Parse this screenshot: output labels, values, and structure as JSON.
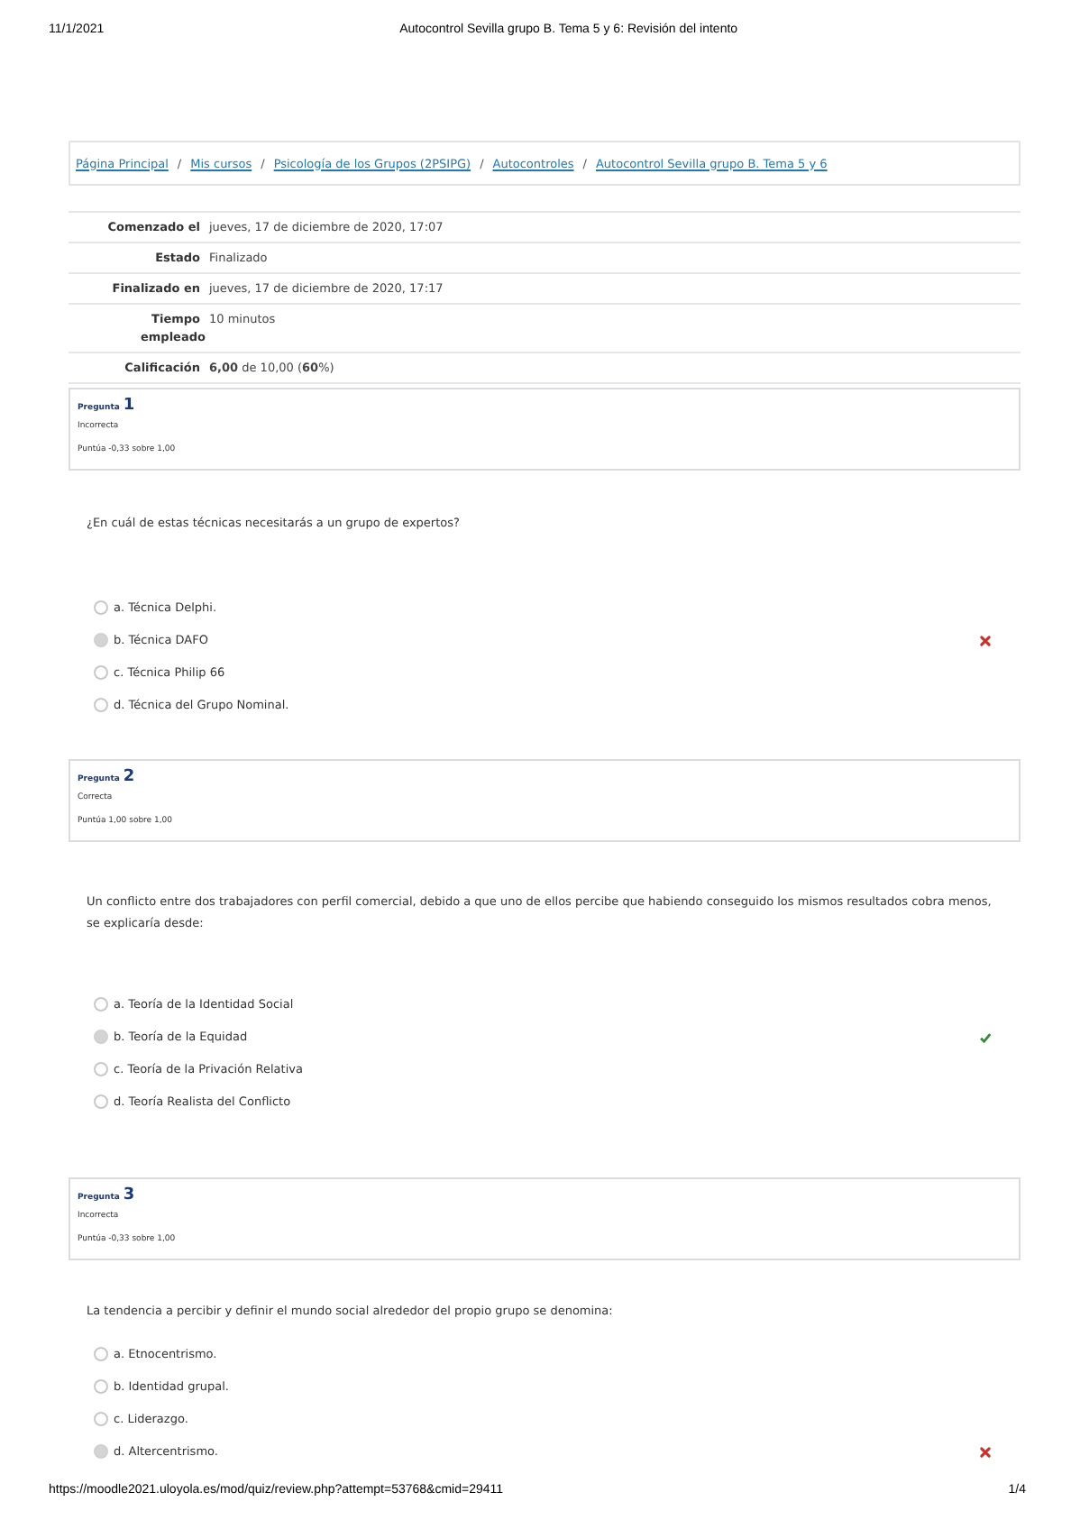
{
  "print_header": {
    "date": "11/1/2021",
    "title": "Autocontrol Sevilla grupo B. Tema 5 y 6: Revisión del intento"
  },
  "breadcrumb": [
    {
      "label": "Página Principal"
    },
    {
      "separator": "/",
      "label": "Mis cursos"
    },
    {
      "separator": "/",
      "label": "Psicología de los Grupos (2PSIPG)"
    },
    {
      "separator": "/",
      "label": "Autocontroles"
    },
    {
      "separator": "/",
      "label": "Autocontrol Sevilla grupo B. Tema 5 y 6"
    }
  ],
  "summary": [
    {
      "label": "Comenzado el",
      "value": "jueves, 17 de diciembre de 2020, 17:07"
    },
    {
      "label": "Estado",
      "value": "Finalizado"
    },
    {
      "label": "Finalizado en",
      "value": "jueves, 17 de diciembre de 2020, 17:17"
    },
    {
      "label": "Tiempo empleado",
      "value": "10 minutos"
    },
    {
      "label": "Calificación",
      "value": "**6,00** de 10,00 (**60**%)"
    }
  ],
  "questions": [
    {
      "label": "Pregunta",
      "number": "1",
      "status": "Incorrecta",
      "score": "Puntúa -0,33 sobre 1,00",
      "text": "¿En cuál de estas técnicas necesitarás a un grupo de expertos?",
      "answers": [
        {
          "text": "a. Técnica Delphi.",
          "selected": false
        },
        {
          "text": "b. Técnica DAFO",
          "selected": true,
          "correct": false
        },
        {
          "text": "c. Técnica Philip 66",
          "selected": false
        },
        {
          "text": "d. Técnica del Grupo Nominal.",
          "selected": false
        }
      ]
    },
    {
      "label": "Pregunta",
      "number": "2",
      "status": "Correcta",
      "score": "Puntúa 1,00 sobre 1,00",
      "text": "Un conflicto entre dos trabajadores con perfil comercial, debido a que uno de ellos percibe que habiendo conseguido los mismos resultados cobra menos, se explicaría desde:",
      "answers": [
        {
          "text": "a. Teoría de la Identidad Social",
          "selected": false
        },
        {
          "text": "b. Teoría de la Equidad",
          "selected": true,
          "correct": true
        },
        {
          "text": "c. Teoría de la Privación Relativa",
          "selected": false
        },
        {
          "text": "d. Teoría Realista del Conflicto",
          "selected": false
        }
      ]
    },
    {
      "label": "Pregunta",
      "number": "3",
      "status": "Incorrecta",
      "score": "Puntúa -0,33 sobre 1,00",
      "text": "La tendencia a percibir y definir el mundo social alrededor del propio grupo se denomina:",
      "answers": [
        {
          "text": "a. Etnocentrismo.",
          "selected": false
        },
        {
          "text": "b. Identidad grupal.",
          "selected": false
        },
        {
          "text": "c. Liderazgo.",
          "selected": false
        },
        {
          "text": "d. Altercentrismo.",
          "selected": true,
          "correct": false
        }
      ]
    }
  ],
  "print_footer": {
    "url": "https://moodle2021.uloyola.es/mod/quiz/review.php?attempt=53768&cmid=29411",
    "page": "1/4"
  }
}
